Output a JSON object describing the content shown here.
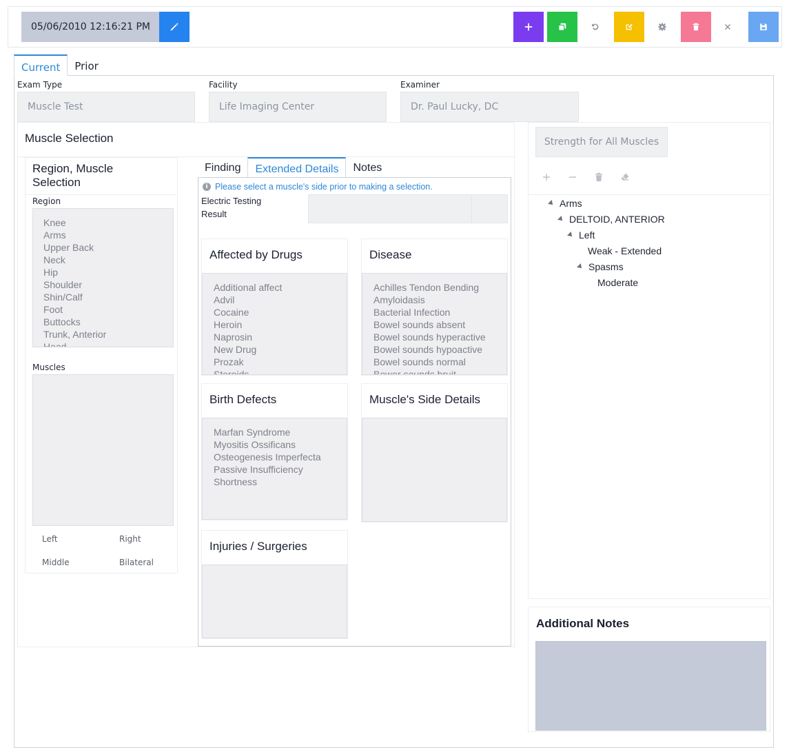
{
  "toolbar": {
    "datetime": "05/06/2010 12:16:21 PM",
    "colors": {
      "edit": "#2583f0",
      "add": "#7b3cf0",
      "copy": "#27c349",
      "notes": "#f5c000",
      "delete": "#f57894",
      "save": "#6aa7f2"
    }
  },
  "tabs": {
    "current": "Current",
    "prior": "Prior"
  },
  "exam": {
    "exam_type_label": "Exam Type",
    "exam_type_value": "Muscle Test",
    "facility_label": "Facility",
    "facility_value": "Life Imaging Center",
    "examiner_label": "Examiner",
    "examiner_value": "Dr. Paul Lucky, DC"
  },
  "muscle_selection": {
    "title": "Muscle Selection",
    "region_panel_title": "Region, Muscle Selection",
    "region_label": "Region",
    "regions": [
      "Knee",
      "Arms",
      "Upper Back",
      "Neck",
      "Hip",
      "Shoulder",
      "Shin/Calf",
      "Foot",
      "Buttocks",
      "Trunk, Anterior",
      "Head"
    ],
    "muscles_label": "Muscles",
    "sides": {
      "left": "Left",
      "right": "Right",
      "middle": "Middle",
      "bilateral": "Bilateral"
    }
  },
  "detail_tabs": {
    "finding": "Finding",
    "extended": "Extended Details",
    "notes": "Notes"
  },
  "extended": {
    "info": "Please select a muscle's side prior to making a selection.",
    "electric_label_1": "Electric Testing",
    "electric_label_2": "Result",
    "drugs_title": "Affected by Drugs",
    "drugs": [
      "Additional affect",
      "Advil",
      "Cocaine",
      "Heroin",
      "Naprosin",
      "New Drug",
      "Prozak",
      "Steroids"
    ],
    "disease_title": "Disease",
    "diseases": [
      "Achilles Tendon Bending",
      "Amyloidasis",
      "Bacterial Infection",
      "Bowel sounds absent",
      "Bowel sounds hyperactive",
      "Bowel sounds hypoactive",
      "Bowel sounds normal",
      "Bower sounds bruit"
    ],
    "birth_title": "Birth Defects",
    "birth": [
      "Marfan Syndrome",
      "Myositis Ossificans",
      "Osteogenesis Imperfecta",
      "Passive Insufficiency",
      "Shortness"
    ],
    "side_details_title": "Muscle's Side Details",
    "injuries_title": "Injuries / Surgeries"
  },
  "strength": {
    "button": "Strength for All Muscles",
    "tree": {
      "arms": "Arms",
      "deltoid": "DELTOID, ANTERIOR",
      "left": "Left",
      "weak": "Weak - Extended",
      "spasms": "Spasms",
      "moderate": "Moderate"
    }
  },
  "notes": {
    "title": "Additional Notes"
  }
}
